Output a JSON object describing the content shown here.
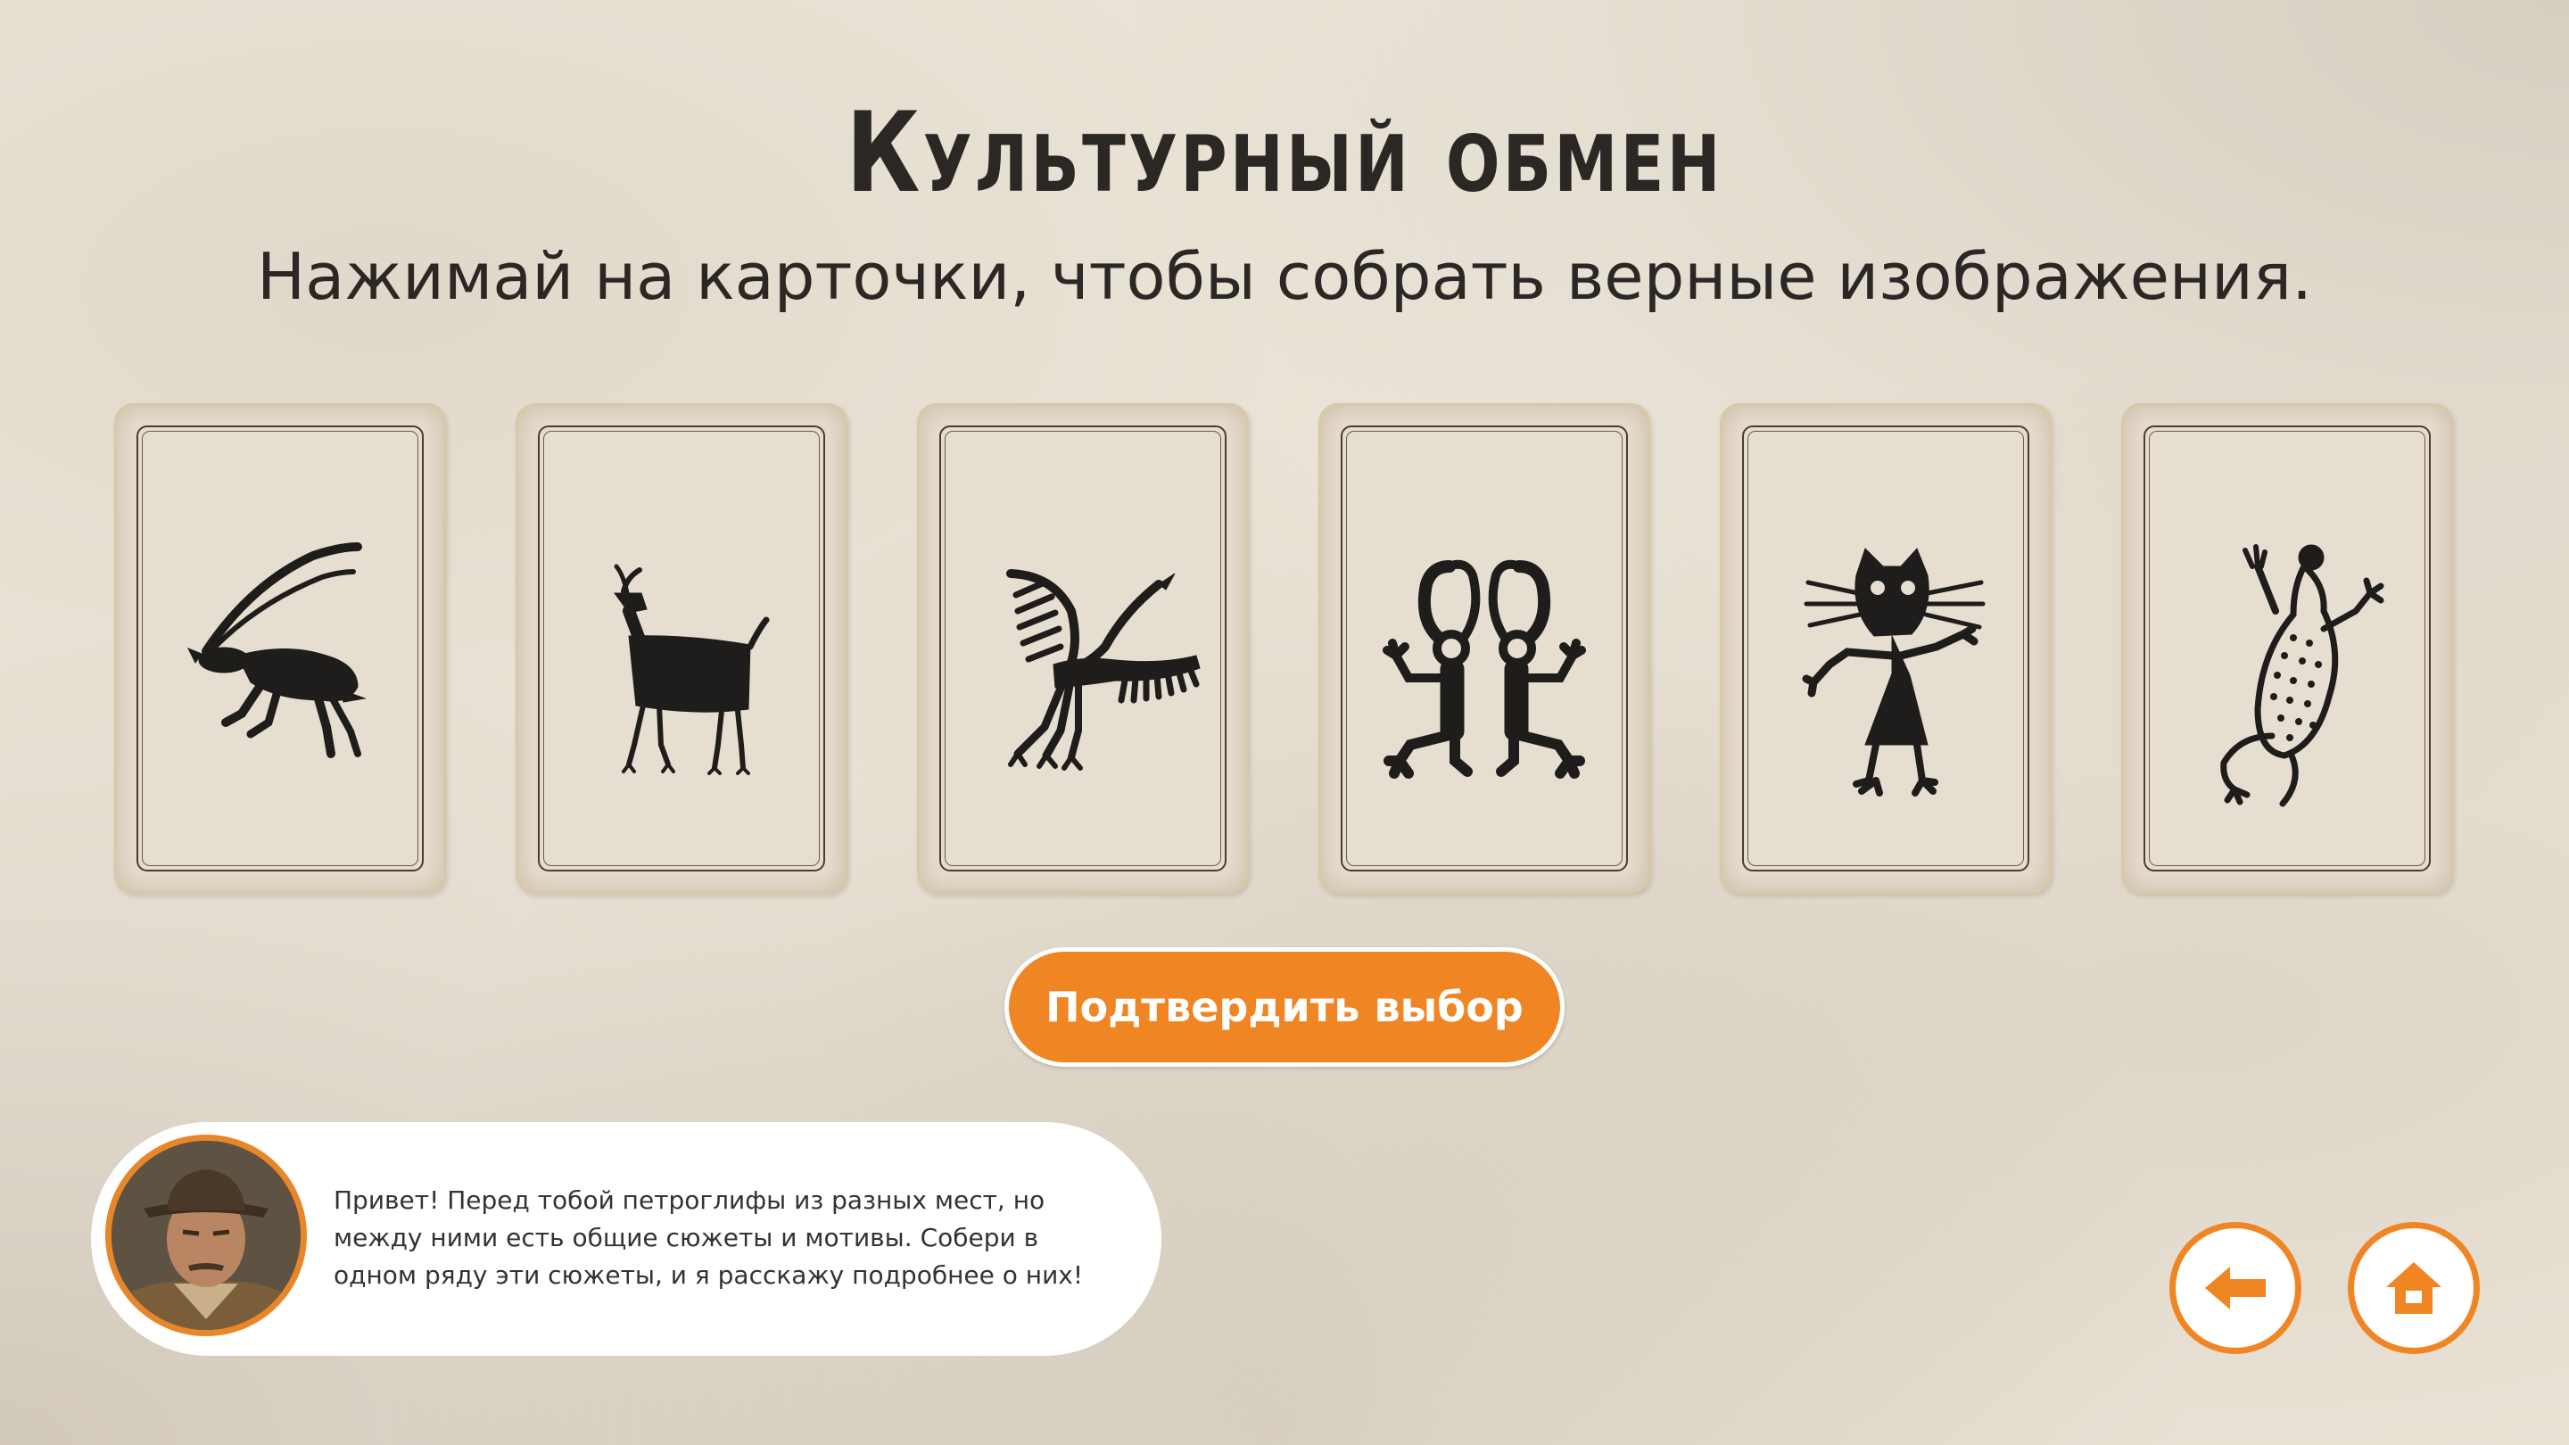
{
  "title": "Культурный обмен",
  "subtitle": "Нажимай на карточки, чтобы собрать верные изображения.",
  "cards": [
    {
      "icon": "ibex-petroglyph-icon"
    },
    {
      "icon": "goat-petroglyph-icon"
    },
    {
      "icon": "bird-petroglyph-icon"
    },
    {
      "icon": "twin-figures-petroglyph-icon"
    },
    {
      "icon": "cat-figure-petroglyph-icon"
    },
    {
      "icon": "lizard-petroglyph-icon"
    }
  ],
  "confirm_label": "Подтвердить выбор",
  "dialog": {
    "text": "Привет! Перед тобой петроглифы из разных мест, но между ними есть общие сюжеты и мотивы. Собери в одном ряду эти сюжеты, и я расскажу подробнее о них!"
  },
  "nav": {
    "back_icon": "arrow-left-icon",
    "home_icon": "home-icon"
  },
  "colors": {
    "accent": "#f08524",
    "text": "#2b2724",
    "glyph": "#1f1d1b"
  }
}
